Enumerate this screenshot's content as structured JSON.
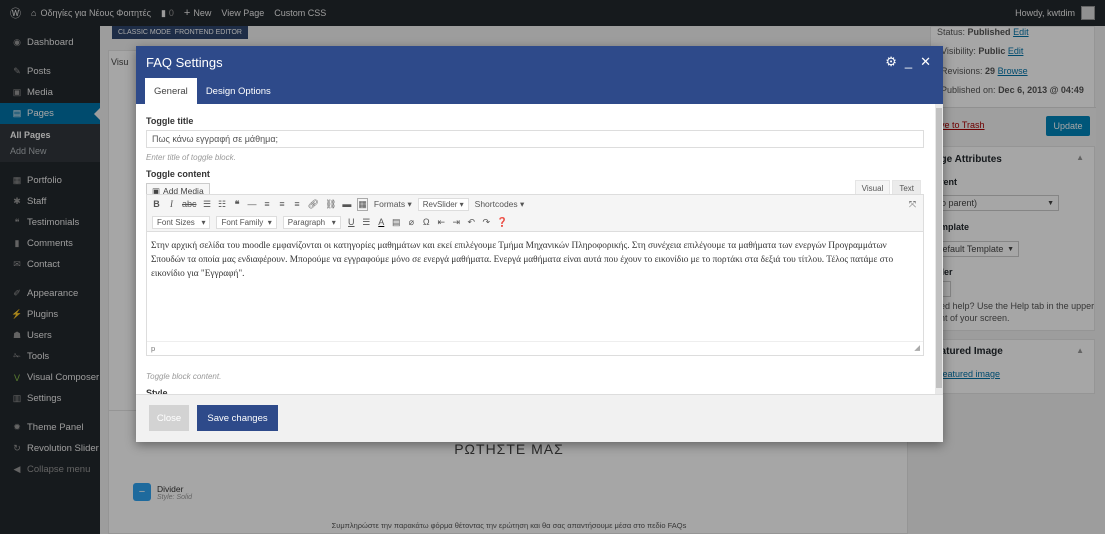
{
  "adminbar": {
    "site_name": "Οδηγίες για Νέους Φοιτητές",
    "comments_count": "0",
    "new_label": "New",
    "view_page_label": "View Page",
    "custom_css_label": "Custom CSS",
    "howdy": "Howdy, kwtdim"
  },
  "sidebar": {
    "dashboard": "Dashboard",
    "posts": "Posts",
    "media": "Media",
    "pages": "Pages",
    "all_pages": "All Pages",
    "add_new": "Add New",
    "portfolio": "Portfolio",
    "staff": "Staff",
    "testimonials": "Testimonials",
    "comments": "Comments",
    "contact": "Contact",
    "appearance": "Appearance",
    "plugins": "Plugins",
    "users": "Users",
    "tools": "Tools",
    "visual_composer": "Visual Composer",
    "settings": "Settings",
    "theme_panel": "Theme Panel",
    "revolution_slider": "Revolution Slider",
    "collapse": "Collapse menu"
  },
  "background": {
    "classic_mode": "CLASSIC MODE",
    "frontend_editor": "FRONTEND EDITOR",
    "visual_tab_partial": "Visu",
    "section_heading": "ΡΩΤΗΣΤΕ ΜΑΣ",
    "divider_label": "Divider",
    "divider_style": "Style: Solid",
    "form_text": "Συμπληρώστε την παρακάτω φόρμα θέτοντας την ερώτηση και θα σας απαντήσουμε μέσα στο πεδίο FAQs"
  },
  "rightcol": {
    "status_label": "Status:",
    "status_value": "Published",
    "status_edit": "Edit",
    "visibility_label": "Visibility:",
    "visibility_value": "Public",
    "visibility_edit": "Edit",
    "revisions_label": "Revisions:",
    "revisions_value": "29",
    "revisions_browse": "Browse",
    "published_label": "Published on:",
    "published_value": "Dec 6, 2013 @ 04:49",
    "trash_link": "ove to Trash",
    "update_button": "Update",
    "page_attributes": "age Attributes",
    "parent_label": "arent",
    "parent_value": "no parent)",
    "template_label": "emplate",
    "template_value": "Default Template",
    "order_label": "rder",
    "order_value": ")",
    "help_line1": "eed help? Use the Help tab in the upper",
    "help_line2": "ght of your screen.",
    "featured_image": "eatured Image",
    "featured_link": "t featured image"
  },
  "modal": {
    "title": "FAQ Settings",
    "tabs": [
      "General",
      "Design Options"
    ],
    "toggle_title_label": "Toggle title",
    "toggle_title_value": "Πως κάνω εγγραφή σε μάθημα;",
    "toggle_title_hint": "Enter title of toggle block.",
    "toggle_content_label": "Toggle content",
    "add_media": "Add Media",
    "editor_tab_visual": "Visual",
    "editor_tab_text": "Text",
    "toolbar": {
      "formats": "Formats",
      "revslider": "RevSlider",
      "shortcodes": "Shortcodes",
      "font_sizes": "Font Sizes",
      "font_family": "Font Family",
      "paragraph": "Paragraph"
    },
    "content": "Στην αρχική σελίδα του moodle εμφανίζονται οι κατηγορίες μαθημάτων και εκεί επιλέγουμε Τμήμα Μηχανικών Πληροφορικής. Στη συνέχεια επιλέγουμε τα μαθήματα των ενεργών Προγραμμάτων Σπουδών τα οποία μας ενδιαφέρουν. Μπορούμε να εγγραφούμε μόνο σε ενεργά μαθήματα. Ενεργά μαθήματα είναι αυτά που έχουν το εικονίδιο με το πορτάκι στα δεξιά του τίτλου. Τέλος πατάμε στο εικονίδιο για \"Εγγραφή\".",
    "editor_path": "p",
    "content_hint": "Toggle block content.",
    "style_label": "Style",
    "close_button": "Close",
    "save_button": "Save changes"
  },
  "colors": {
    "modal_header": "#2e4a8a",
    "save_button": "#2e4a8a",
    "wp_blue": "#0073aa",
    "admin_dark": "#23282d"
  }
}
